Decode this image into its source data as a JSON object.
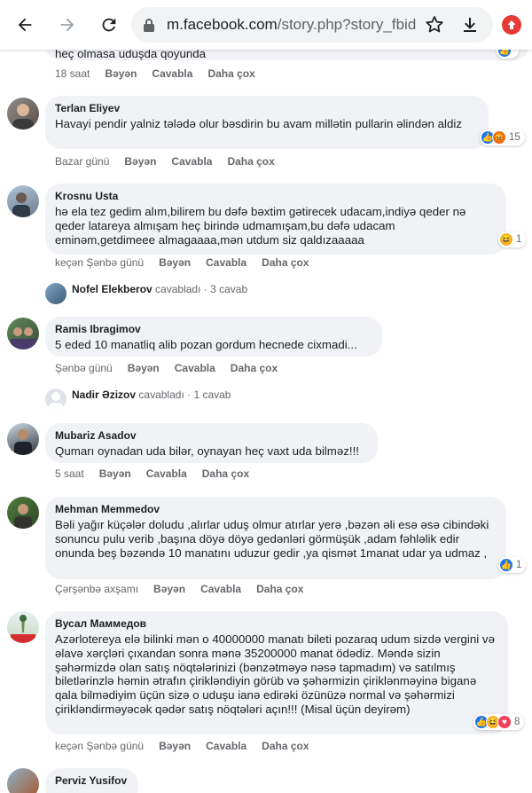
{
  "browser": {
    "url_main": "m.facebook.com",
    "url_path": "/story.php?story_fbid=4"
  },
  "comments": [
    {
      "text_partial": "heç olmasa uduşda qoyunda",
      "time": "18 saat",
      "like": "Bəyən",
      "reply": "Cavabla",
      "more": "Daha çox"
    },
    {
      "author": "Terlan Eliyev",
      "text": "Havayi pendir yalniz tələdə olur bəsdirin bu avam millətin pullarin əlindən aldiz",
      "time": "Bazar günü",
      "like": "Bəyən",
      "reply": "Cavabla",
      "more": "Daha çox",
      "reaction_count": "15"
    },
    {
      "author": "Krosnu Usta",
      "text": "hə ela tez gedim alım,bilirem bu dəfə bəxtim gətirecek udacam,indiyə qeder nə qeder latareya almışam heç birində udmamışam,bu dəfə udacam eminəm,getdimeee almagaaaa,mən utdum siz qaldızaaaaa",
      "time": "keçən Şənbə günü",
      "like": "Bəyən",
      "reply": "Cavabla",
      "more": "Daha çox",
      "reaction_count": "1",
      "reply_name": "Nofel Elekberov",
      "reply_verb": "cavabladı",
      "reply_count": "· 3 cavab"
    },
    {
      "author": "Ramis Ibragimov",
      "text": "5 eded 10 manatliq alib pozan gordum hecnede cixmadi...",
      "time": "Şənbə günü",
      "like": "Bəyən",
      "reply": "Cavabla",
      "more": "Daha çox",
      "reply_name": "Nadir Əzizov",
      "reply_verb": "cavabladı",
      "reply_count": "· 1 cavab"
    },
    {
      "author": "Mubariz Asadov",
      "text": "Qumarı oynadan uda bilər, oynayan heç vaxt uda bilməz!!!",
      "time": "5 saat",
      "like": "Bəyən",
      "reply": "Cavabla",
      "more": "Daha çox"
    },
    {
      "author": "Mehman Memmedov",
      "text": "Bəli yağır küçələr doludu ,alırlar uduş olmur atırlar yerə ,bəzən əli esə əsə cibindəki sonuncu pulu verib ,başına döyə döyə gedənləri görmüşük ,adam fəhləlik edir onunda beş bəzəndə 10 manatını uduzur gedir ,ya qismət 1manat udar ya udmaz ,",
      "time": "Çərşənbə axşamı",
      "like": "Bəyən",
      "reply": "Cavabla",
      "more": "Daha çox",
      "reaction_count": "1"
    },
    {
      "author": "Вусал Маммедов",
      "text": "Azərlotereya elə bilinki mən o 40000000 manatı bileti pozaraq udum sizdə vergini və əlavə xərçləri çıxandan sonra mənə 35200000 manat ödədiz. Məndə sizin şəhərmizdə olan satış nöqtələrinizi (bənzətməyə nəsə tapmadım) və satılmış biletlərinzlə həmin ətrafın çirikləndiyin görüb və şəhərmizin çiriklənməyinə biganə qala bilmədiyim üçün sizə o uduşu ianə edirəki özünüzə normal və şəhərmizi çiriklən­dirməyəcək qədər satış nöqtələri açın!!! (Misal üçün deyirəm)",
      "time": "keçən Şənbə günü",
      "like": "Bəyən",
      "reply": "Cavabla",
      "more": "Daha çox",
      "reaction_count": "8"
    },
    {
      "author": "Perviz Yusifov"
    }
  ]
}
